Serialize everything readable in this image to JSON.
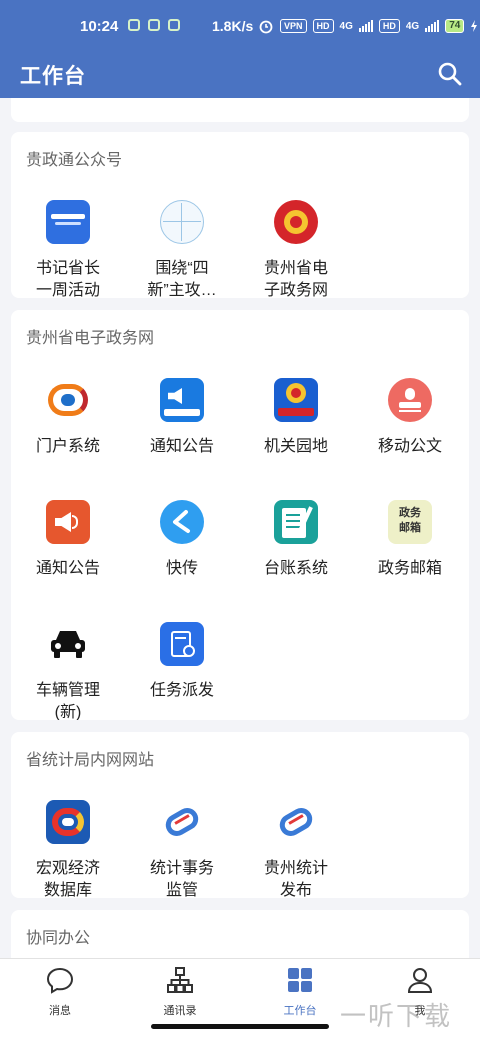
{
  "status_bar": {
    "time": "10:24",
    "net_speed": "1.8K/s",
    "vpn": "VPN",
    "hd1": "HD",
    "net1": "4G",
    "hd2": "HD",
    "net2": "4G",
    "battery": "74"
  },
  "header": {
    "title": "工作台",
    "search_icon": "search-icon"
  },
  "sections": [
    {
      "title": "贵政通公众号",
      "items": [
        {
          "label": "书记省长\n一周活动",
          "icon": "weekly-activity-icon"
        },
        {
          "label": "围绕“四\n新”主攻…",
          "icon": "four-new-icon"
        },
        {
          "label": "贵州省电\n子政务网",
          "icon": "national-emblem-icon"
        }
      ]
    },
    {
      "title": "贵州省电子政务网",
      "items": [
        {
          "label": "门户系统",
          "icon": "portal-icon"
        },
        {
          "label": "通知公告",
          "icon": "notice-board-icon"
        },
        {
          "label": "机关园地",
          "icon": "agency-garden-icon"
        },
        {
          "label": "移动公文",
          "icon": "stamp-icon"
        },
        {
          "label": "通知公告",
          "icon": "speaker-icon"
        },
        {
          "label": "快传",
          "icon": "quick-send-icon"
        },
        {
          "label": "台账系统",
          "icon": "ledger-icon"
        },
        {
          "label": "政务邮箱",
          "icon": "mailbox-icon",
          "icon_text": "政务\n邮箱"
        },
        {
          "label": "车辆管理\n(新)",
          "icon": "car-icon"
        },
        {
          "label": "任务派发",
          "icon": "task-dispatch-icon"
        }
      ]
    },
    {
      "title": "省统计局内网网站",
      "items": [
        {
          "label": "宏观经济\n数据库",
          "icon": "macro-economy-icon"
        },
        {
          "label": "统计事务\n监管",
          "icon": "statistics-supervision-icon"
        },
        {
          "label": "贵州统计\n发布",
          "icon": "statistics-release-icon"
        }
      ]
    },
    {
      "title": "协同办公",
      "items": []
    }
  ],
  "tabs": [
    {
      "label": "消息",
      "icon": "chat-bubble-icon",
      "active": false
    },
    {
      "label": "通讯录",
      "icon": "org-chart-icon",
      "active": false
    },
    {
      "label": "工作台",
      "icon": "grid-icon",
      "active": true
    },
    {
      "label": "我",
      "icon": "person-icon",
      "active": false
    }
  ],
  "watermark": "一听下载",
  "colors": {
    "header_bg": "#4a73c2",
    "page_bg": "#f3f4f8",
    "active_tab": "#4a73c2"
  }
}
